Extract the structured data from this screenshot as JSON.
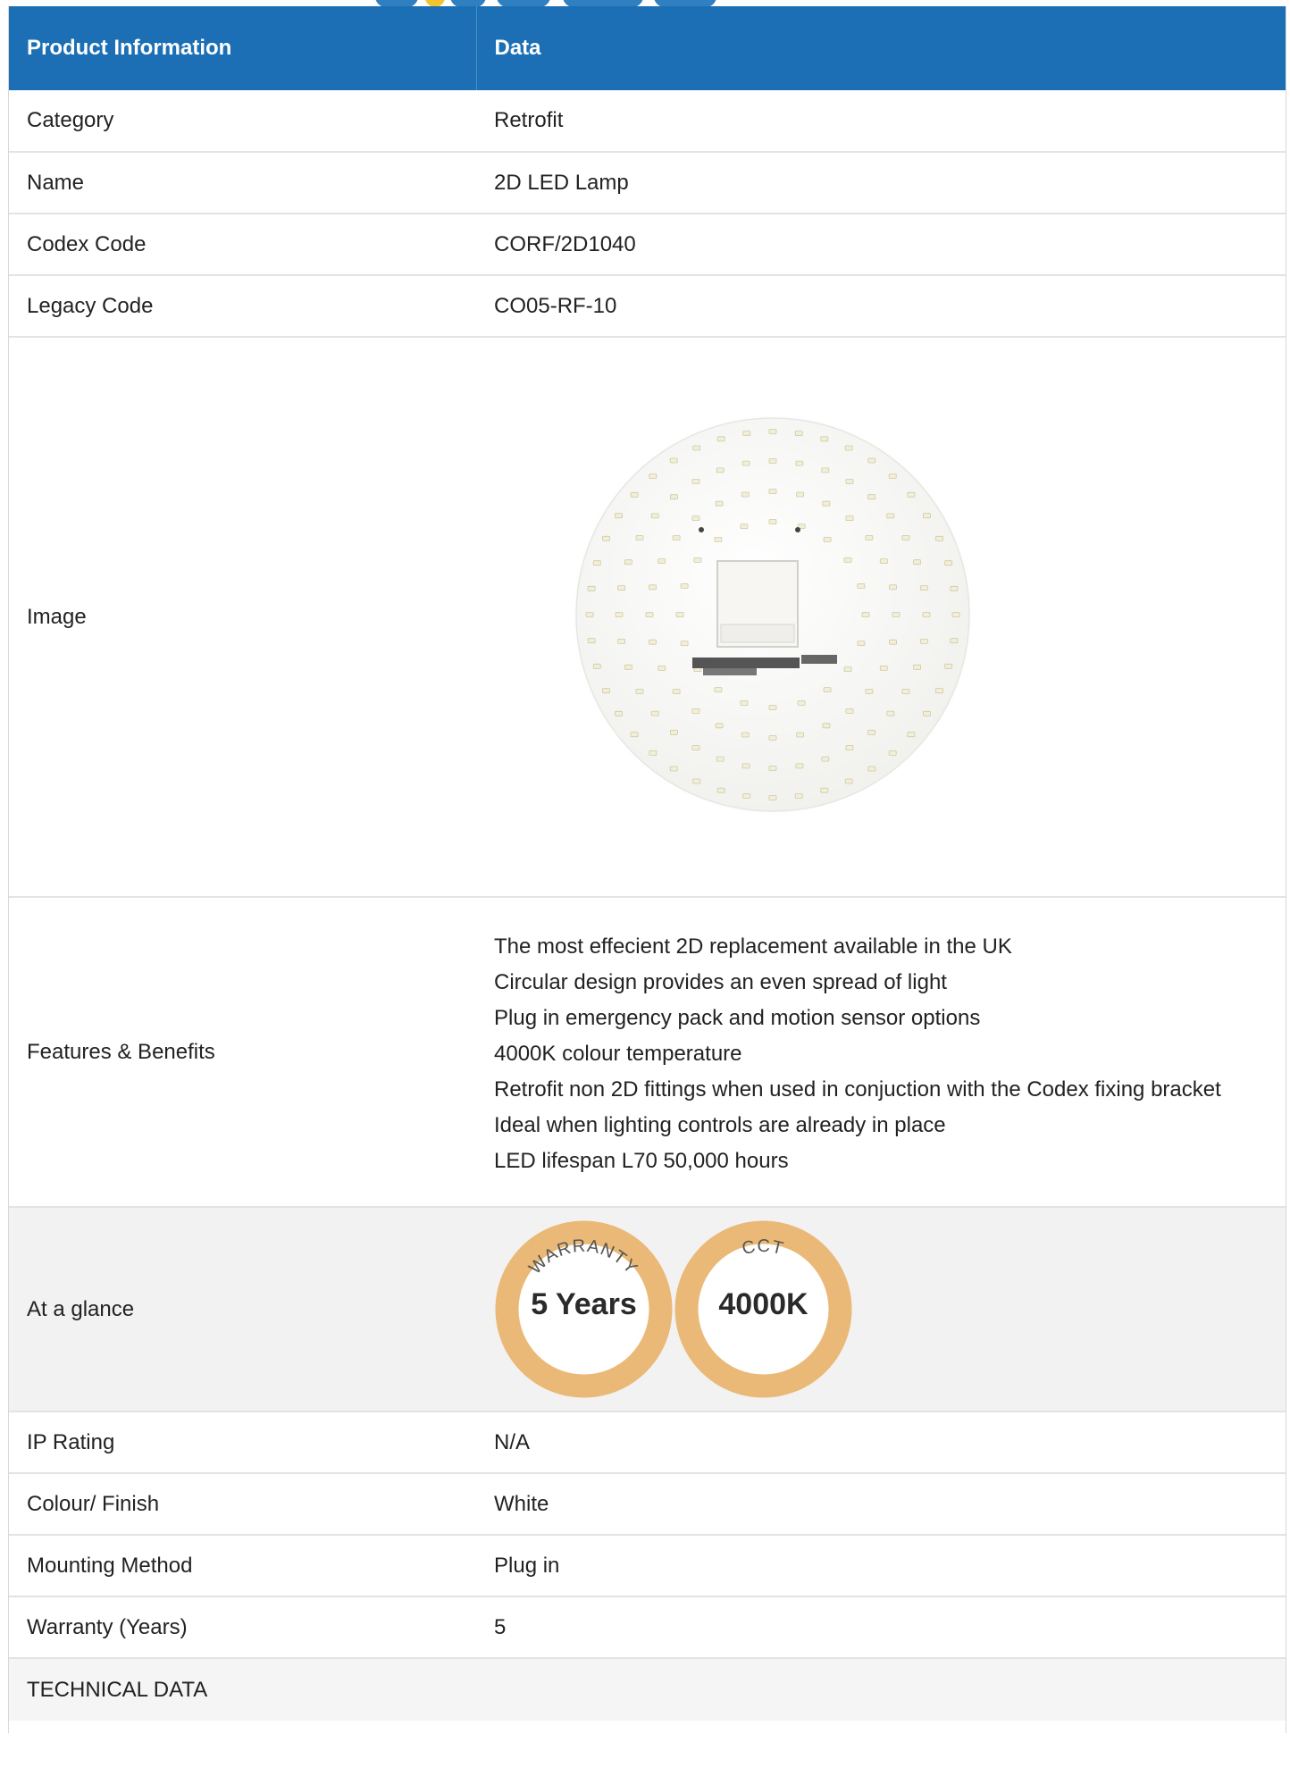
{
  "colors": {
    "header_bg": "#1c6fb4",
    "header_text": "#ffffff",
    "row_border": "#e3e3e3",
    "glance_bg": "#f2f2f2",
    "badge_ring": "#eab977",
    "badge_text": "#2a2a2a"
  },
  "table": {
    "headers": [
      "Product Information",
      "Data"
    ],
    "rows": {
      "category": {
        "label": "Category",
        "value": "Retrofit"
      },
      "name": {
        "label": "Name",
        "value": "2D LED Lamp"
      },
      "codex_code": {
        "label": "Codex Code",
        "value": "CORF/2D1040"
      },
      "legacy_code": {
        "label": "Legacy Code",
        "value": "CO05-RF-10"
      },
      "image": {
        "label": "Image",
        "image_icon": "circular-led-board-image"
      },
      "features": {
        "label": "Features & Benefits",
        "items": [
          "The most effecient 2D replacement available in the UK",
          "Circular design provides an even spread of light",
          "Plug in emergency pack and motion sensor options",
          "4000K colour temperature",
          "Retrofit non 2D fittings when used in conjuction with the Codex fixing bracket",
          "Ideal when lighting controls are already in place",
          "LED lifespan L70 50,000 hours"
        ]
      },
      "at_a_glance": {
        "label": "At a glance",
        "badges": [
          {
            "arc_text": "WARRANTY",
            "value": "5 Years"
          },
          {
            "arc_text": "CCT",
            "value": "4000K"
          }
        ]
      },
      "ip_rating": {
        "label": "IP Rating",
        "value": "N/A"
      },
      "colour_finish": {
        "label": "Colour/ Finish",
        "value": "White"
      },
      "mounting_method": {
        "label": "Mounting Method",
        "value": "Plug in"
      },
      "warranty_years": {
        "label": "Warranty (Years)",
        "value": "5"
      },
      "technical_data": {
        "label": "TECHNICAL DATA"
      }
    }
  }
}
